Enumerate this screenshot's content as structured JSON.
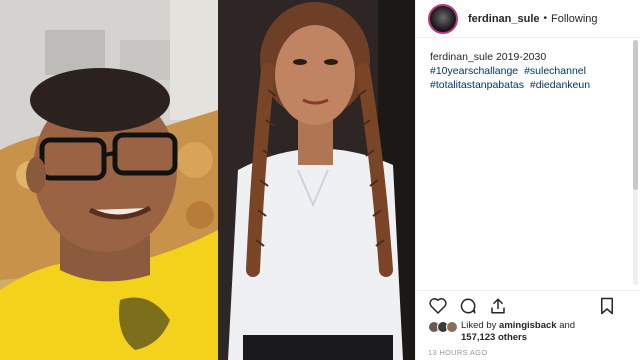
{
  "post": {
    "username": "ferdinan_sule",
    "follow_status": "Following",
    "separator": "•",
    "caption_text": "2019-2030",
    "hashtags": [
      "#10yearschallange",
      "#sulechannel",
      "#totalitastanpabatas",
      "#diedankeun"
    ],
    "liked_by_prefix": "Liked by",
    "liked_by_user": "amingisback",
    "liked_by_and": "and",
    "likes_count": "157,123 others",
    "timestamp": "13 HOURS AGO"
  },
  "icons": {
    "like": "heart-icon",
    "comment": "comment-icon",
    "share": "share-icon",
    "save": "bookmark-icon"
  },
  "colors": {
    "hashtag": "#003569",
    "text": "#262626",
    "avatar_ring": "#c13584",
    "yellow_shirt": "#f3d21c"
  }
}
